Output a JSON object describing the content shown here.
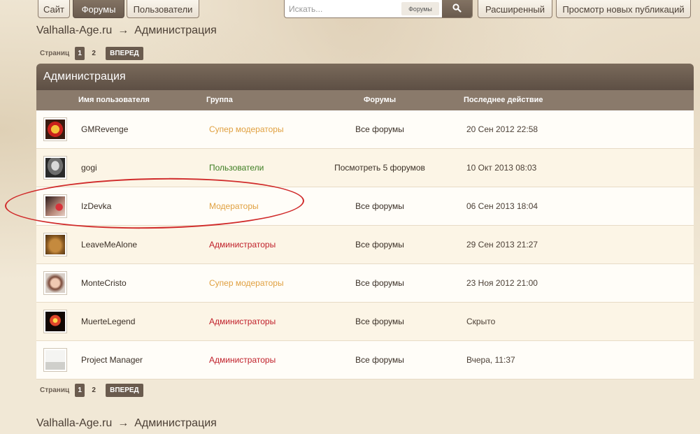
{
  "nav": {
    "site": "Сайт",
    "forums": "Форумы",
    "users": "Пользователи",
    "advanced": "Расширенный",
    "new_posts": "Просмотр новых публикаций"
  },
  "search": {
    "placeholder": "Искать...",
    "scope": "Форумы"
  },
  "breadcrumb": {
    "home": "Valhalla-Age.ru",
    "arrow": "→",
    "current": "Администрация"
  },
  "pager": {
    "label": "Страниц",
    "pages": [
      "1",
      "2"
    ],
    "next": "ВПЕРЕД"
  },
  "panel": {
    "title": "Администрация",
    "columns": {
      "username": "Имя пользователя",
      "group": "Группа",
      "forums": "Форумы",
      "last_action": "Последнее действие"
    }
  },
  "colors": {
    "super_moderators": "#e08a16",
    "users": "#3c7d22",
    "moderators": "#e08a16",
    "administrators": "#c0202a",
    "circle": "#d02a2a"
  },
  "rows": [
    {
      "name": "GMRevenge",
      "group": "Супер модераторы",
      "group_color": "#e0a040",
      "forums": "Все форумы",
      "last": "20 Сен 2012 22:58"
    },
    {
      "name": "gogi",
      "group": "Пользователи",
      "group_color": "#3c7d22",
      "forums": "Посмотреть 5 форумов",
      "last": "10 Окт 2013 08:03"
    },
    {
      "name": "IzDevka",
      "group": "Модераторы",
      "group_color": "#e0a040",
      "forums": "Все форумы",
      "last": "06 Сен 2013 18:04"
    },
    {
      "name": "LeaveMeAlone",
      "group": "Администраторы",
      "group_color": "#c0202a",
      "forums": "Все форумы",
      "last": "29 Сен 2013 21:27"
    },
    {
      "name": "MonteCristo",
      "group": "Супер модераторы",
      "group_color": "#e0a040",
      "forums": "Все форумы",
      "last": "23 Ноя 2012 21:00"
    },
    {
      "name": "MuerteLegend",
      "group": "Администраторы",
      "group_color": "#c0202a",
      "forums": "Все форумы",
      "last": "Скрыто"
    },
    {
      "name": "Project Manager",
      "group": "Администраторы",
      "group_color": "#c0202a",
      "forums": "Все форумы",
      "last": "Вчера, 11:37"
    }
  ]
}
